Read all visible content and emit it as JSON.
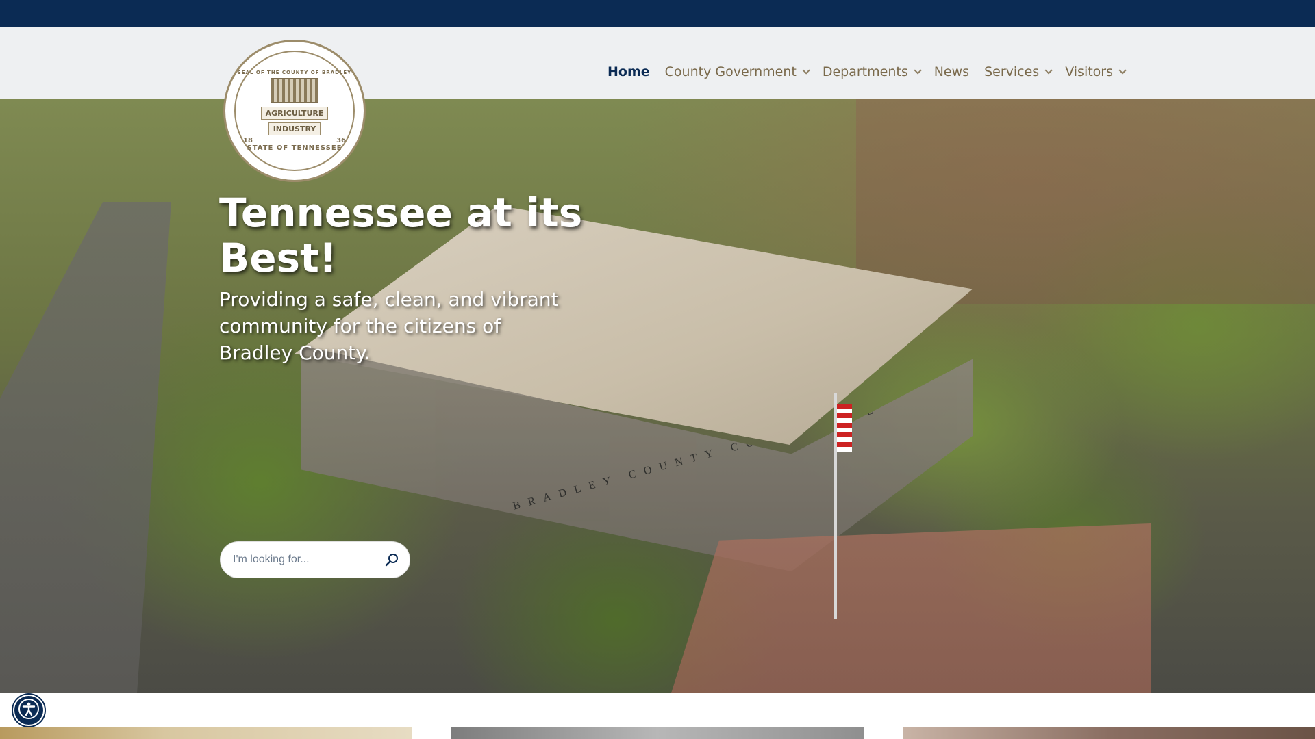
{
  "header": {
    "logo": {
      "ring_text": "SEAL OF THE COUNTY OF BRADLEY",
      "banner_top": "AGRICULTURE",
      "banner_bottom": "INDUSTRY",
      "bottom_text": "STATE OF TENNESSEE",
      "num_left": "18",
      "num_right": "36"
    },
    "nav": [
      {
        "label": "Home",
        "active": true,
        "has_dropdown": false
      },
      {
        "label": "County Government",
        "active": false,
        "has_dropdown": true
      },
      {
        "label": "Departments",
        "active": false,
        "has_dropdown": true
      },
      {
        "label": "News",
        "active": false,
        "has_dropdown": false
      },
      {
        "label": "Services",
        "active": false,
        "has_dropdown": true
      },
      {
        "label": "Visitors",
        "active": false,
        "has_dropdown": true
      }
    ]
  },
  "hero": {
    "title": "Tennessee at its Best!",
    "subtitle": "Providing a safe, clean, and vibrant community for the citizens of Bradley County.",
    "image_text": "BRADLEY COUNTY COURTHOUSE",
    "search": {
      "placeholder": "I'm looking for...",
      "value": "",
      "icon": "search-icon"
    }
  },
  "accessibility": {
    "icon": "accessibility-icon"
  },
  "colors": {
    "topbar": "#0b2b54",
    "nav_active": "#0b2b54",
    "nav_text": "#7a6a4c",
    "navbar_bg": "#eef0f2"
  }
}
